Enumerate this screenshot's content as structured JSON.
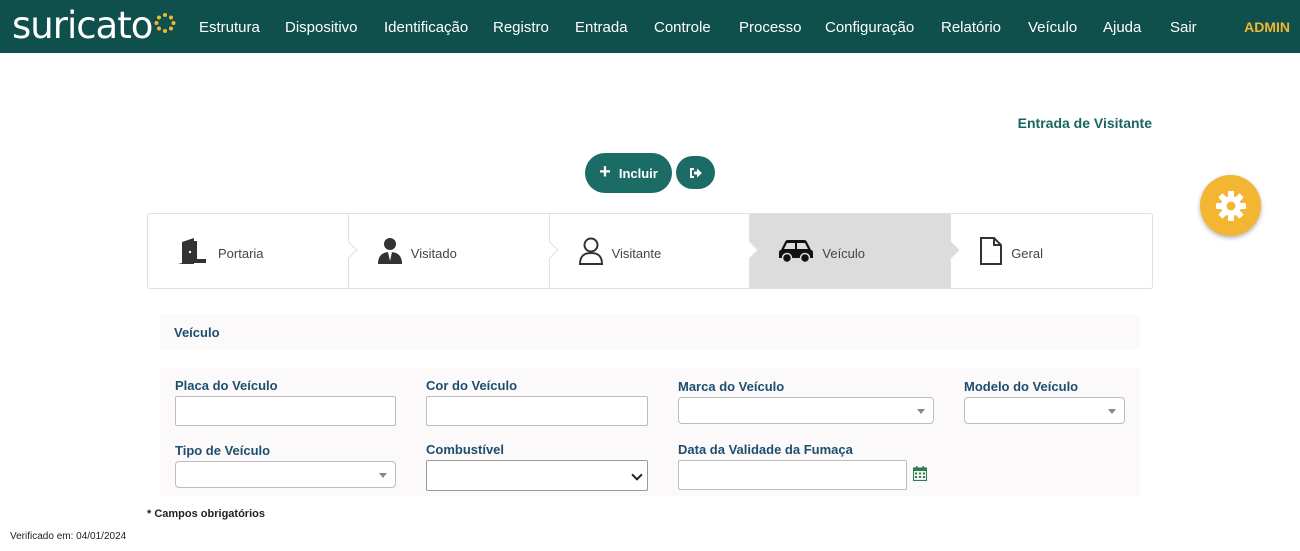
{
  "brand": {
    "logo_text": "suricato"
  },
  "nav": {
    "items": [
      "Estrutura",
      "Dispositivo",
      "Identificação",
      "Registro",
      "Entrada",
      "Controle",
      "Processo",
      "Configuração",
      "Relatório",
      "Veículo",
      "Ajuda",
      "Sair"
    ],
    "user": "ADMIN"
  },
  "page": {
    "title": "Entrada de Visitante"
  },
  "actions": {
    "incluir_label": "Incluir"
  },
  "steps": [
    {
      "label": "Portaria",
      "icon": "door-icon"
    },
    {
      "label": "Visitado",
      "icon": "businessman-icon"
    },
    {
      "label": "Visitante",
      "icon": "user-outline-icon"
    },
    {
      "label": "Veículo",
      "icon": "car-icon",
      "active": true
    },
    {
      "label": "Geral",
      "icon": "document-icon"
    }
  ],
  "section": {
    "title": "Veículo"
  },
  "form": {
    "placa_label": "Placa do Veículo",
    "placa_value": "",
    "cor_label": "Cor do Veículo",
    "cor_value": "",
    "marca_label": "Marca do Veículo",
    "marca_value": "",
    "modelo_label": "Modelo do Veículo",
    "modelo_value": "",
    "tipo_label": "Tipo de Veículo",
    "tipo_value": "",
    "combustivel_label": "Combustível",
    "combustivel_value": "",
    "fumaca_label": "Data da Validade da Fumaça",
    "fumaca_value": ""
  },
  "footer": {
    "required_note": "* Campos obrigatórios",
    "verified": "Verificado em: 04/01/2024"
  },
  "colors": {
    "navbar": "#0f4f4c",
    "accent": "#1b6b67",
    "admin": "#f2b632",
    "fab": "#f2b632",
    "label": "#1e4e6e"
  }
}
